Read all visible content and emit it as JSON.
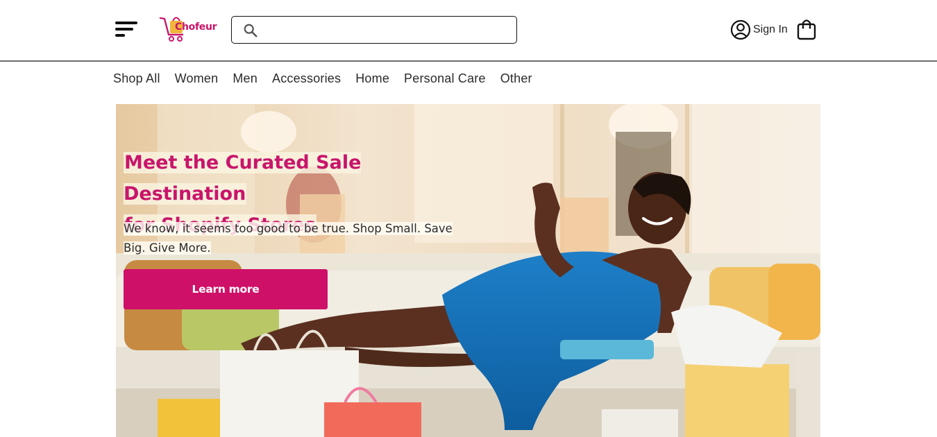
{
  "header": {
    "logo_text": "Chofeur",
    "search": {
      "value": "",
      "placeholder": ""
    },
    "sign_in_label": "Sign In"
  },
  "nav": {
    "categories": [
      "Shop All",
      "Women",
      "Men",
      "Accessories",
      "Home",
      "Personal Care",
      "Other"
    ]
  },
  "hero": {
    "title_line1": "Meet the Curated Sale Destination",
    "title_line2": "for Shopify Stores",
    "subtitle_line1": "We know, it seems too good to be true. Shop Small. Save",
    "subtitle_line2": "Big. Give More.",
    "cta_label": "Learn more"
  },
  "colors": {
    "brand": "#c8156b",
    "cta": "#cf1068",
    "logo_bag": "#f2b63a",
    "text": "#2b2b2b",
    "header_border": "#6b6b6b"
  },
  "icons": [
    "menu-icon",
    "shopping-cart-logo-icon",
    "search-icon",
    "user-circle-icon",
    "shopping-bag-icon"
  ]
}
